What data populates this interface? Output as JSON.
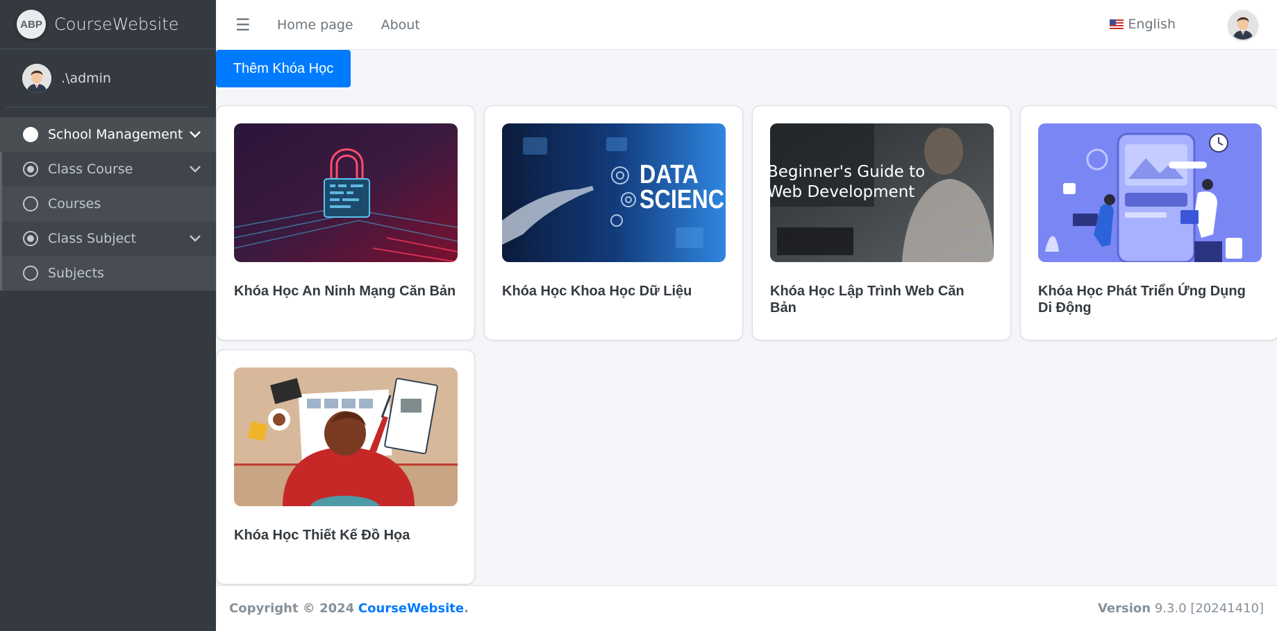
{
  "app": {
    "brand": "CourseWebsite",
    "logo_text": "ABP"
  },
  "user": {
    "name": ".\\admin"
  },
  "sidebar": {
    "items": [
      {
        "label": "School Management",
        "icon": "circle-filled-icon",
        "expanded": true
      },
      {
        "label": "Class Course",
        "icon": "circle-dot-icon",
        "expanded": true
      },
      {
        "label": "Courses",
        "icon": "circle-outline-icon"
      },
      {
        "label": "Class Subject",
        "icon": "circle-dot-icon",
        "expanded": true
      },
      {
        "label": "Subjects",
        "icon": "circle-outline-icon"
      }
    ]
  },
  "header": {
    "menu_icon": "hamburger-icon",
    "links": [
      "Home page",
      "About"
    ],
    "language": "English"
  },
  "main": {
    "add_button": "Thêm Khóa Học",
    "courses": [
      {
        "title": "Khóa Học An Ninh Mạng Căn Bản",
        "image": "cyber-security-lock-image"
      },
      {
        "title": "Khóa Học Khoa Học Dữ Liệu",
        "image": "data-science-image",
        "image_text": [
          "DATA",
          "SCIENCE"
        ]
      },
      {
        "title": "Khóa Học Lập Trình Web Căn Bản",
        "image": "web-development-image",
        "image_text": [
          "Beginner's Guide to",
          "Web Development"
        ]
      },
      {
        "title": "Khóa Học Phát Triển Ứng Dụng Di Động",
        "image": "mobile-app-development-image"
      },
      {
        "title": "Khóa Học Thiết Kế Đồ Họa",
        "image": "graphic-design-image"
      }
    ]
  },
  "footer": {
    "copyright": "Copyright © 2024",
    "brand": "CourseWebsite",
    "period": ".",
    "version_label": "Version",
    "version_value": "9.3.0 [20241410]"
  },
  "colors": {
    "primary": "#007bff",
    "sidebar": "#343a40",
    "background": "#f4f6f9"
  }
}
